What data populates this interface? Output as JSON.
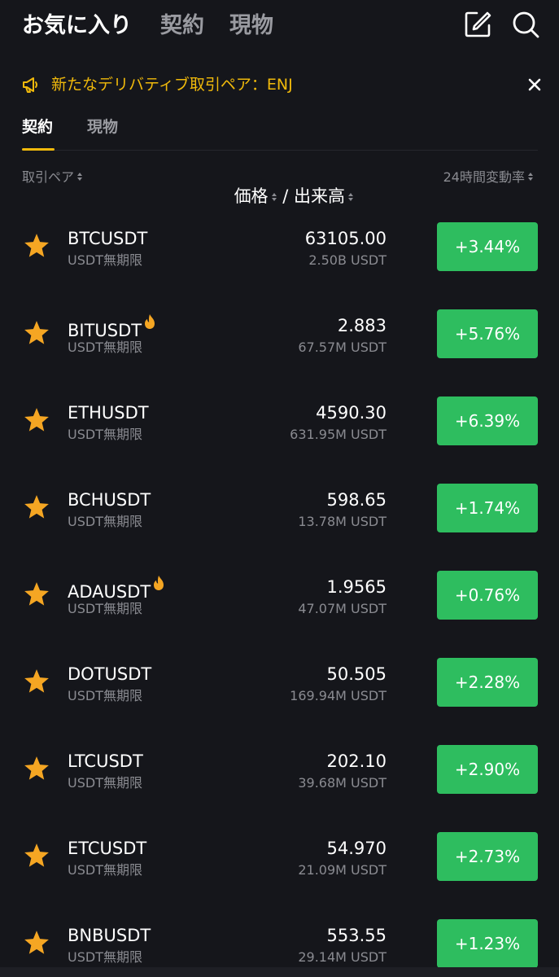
{
  "header": {
    "tabs": [
      {
        "label": "お気に入り"
      },
      {
        "label": "契約"
      },
      {
        "label": "現物"
      }
    ],
    "edit_icon": "edit-icon",
    "search_icon": "search-icon"
  },
  "announcement": {
    "text": "新たなデリバティブ取引ペア：ENJ",
    "icon": "megaphone-icon"
  },
  "subtabs": [
    {
      "label": "契約"
    },
    {
      "label": "現物"
    }
  ],
  "columns": {
    "pair": "取引ペア",
    "price": "価格",
    "separator": " / ",
    "volume": "出来高",
    "change": "24時間変動率"
  },
  "colors": {
    "accent": "#f0b90b",
    "positive": "#2ebd5f",
    "background": "#15161b"
  },
  "rows": [
    {
      "symbol": "BTCUSDT",
      "hot": false,
      "type": "USDT無期限",
      "price": "63105.00",
      "volume": "2.50B USDT",
      "change": "+3.44%"
    },
    {
      "symbol": "BITUSDT",
      "hot": true,
      "type": "USDT無期限",
      "price": "2.883",
      "volume": "67.57M USDT",
      "change": "+5.76%"
    },
    {
      "symbol": "ETHUSDT",
      "hot": false,
      "type": "USDT無期限",
      "price": "4590.30",
      "volume": "631.95M USDT",
      "change": "+6.39%"
    },
    {
      "symbol": "BCHUSDT",
      "hot": false,
      "type": "USDT無期限",
      "price": "598.65",
      "volume": "13.78M USDT",
      "change": "+1.74%"
    },
    {
      "symbol": "ADAUSDT",
      "hot": true,
      "type": "USDT無期限",
      "price": "1.9565",
      "volume": "47.07M USDT",
      "change": "+0.76%"
    },
    {
      "symbol": "DOTUSDT",
      "hot": false,
      "type": "USDT無期限",
      "price": "50.505",
      "volume": "169.94M USDT",
      "change": "+2.28%"
    },
    {
      "symbol": "LTCUSDT",
      "hot": false,
      "type": "USDT無期限",
      "price": "202.10",
      "volume": "39.68M USDT",
      "change": "+2.90%"
    },
    {
      "symbol": "ETCUSDT",
      "hot": false,
      "type": "USDT無期限",
      "price": "54.970",
      "volume": "21.09M USDT",
      "change": "+2.73%"
    },
    {
      "symbol": "BNBUSDT",
      "hot": false,
      "type": "USDT無期限",
      "price": "553.55",
      "volume": "29.14M USDT",
      "change": "+1.23%"
    }
  ]
}
